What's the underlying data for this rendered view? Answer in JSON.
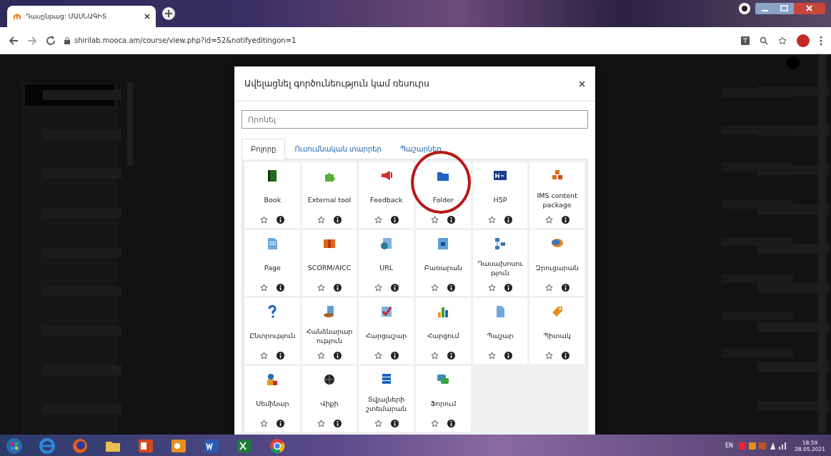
{
  "browser": {
    "tab_title": "Դասընթաց: ՄԱՍՆԱԳԻՏ",
    "url": "shirilab.mooca.am/course/view.php?id=52&notifyeditingon=1"
  },
  "dialog": {
    "title": "Ավելացնել գործունեություն կամ ռեսուրս",
    "search": {
      "placeholder": "Որոնել"
    },
    "tabs": [
      {
        "label": "Բոլորը",
        "selected": true
      },
      {
        "label": "Ուսումնական տարրեր",
        "selected": false
      },
      {
        "label": "Պաշարներ",
        "selected": false
      }
    ],
    "items": [
      {
        "label": "Book",
        "starred": false
      },
      {
        "label": "External tool",
        "starred": false
      },
      {
        "label": "Feedback",
        "starred": false
      },
      {
        "label": "Folder",
        "starred": false
      },
      {
        "label": "H5P",
        "starred": false
      },
      {
        "label": "IMS content package",
        "starred": false
      },
      {
        "label": "Page",
        "starred": false
      },
      {
        "label": "SCORM/AICC",
        "starred": false
      },
      {
        "label": "URL",
        "starred": false
      },
      {
        "label": "Բառարան",
        "starred": false
      },
      {
        "label": "Դասախոսություն",
        "starred": false
      },
      {
        "label": "Զրուցարան",
        "starred": false
      },
      {
        "label": "Ընտրություն",
        "starred": false
      },
      {
        "label": "Հանձնարարություն",
        "starred": false
      },
      {
        "label": "Հարցաշար",
        "starred": false
      },
      {
        "label": "Հարցում",
        "starred": false
      },
      {
        "label": "Պաշար",
        "starred": false
      },
      {
        "label": "Պիտակ",
        "starred": false
      },
      {
        "label": "Սեմինար",
        "starred": false
      },
      {
        "label": "Վիքի",
        "starred": false
      },
      {
        "label": "Տվյալների շտեմարան",
        "starred": false
      },
      {
        "label": "Ֆորում",
        "starred": false
      }
    ]
  },
  "taskbar": {
    "language": "EN",
    "time": "18:59",
    "date": "28.05.2021"
  }
}
